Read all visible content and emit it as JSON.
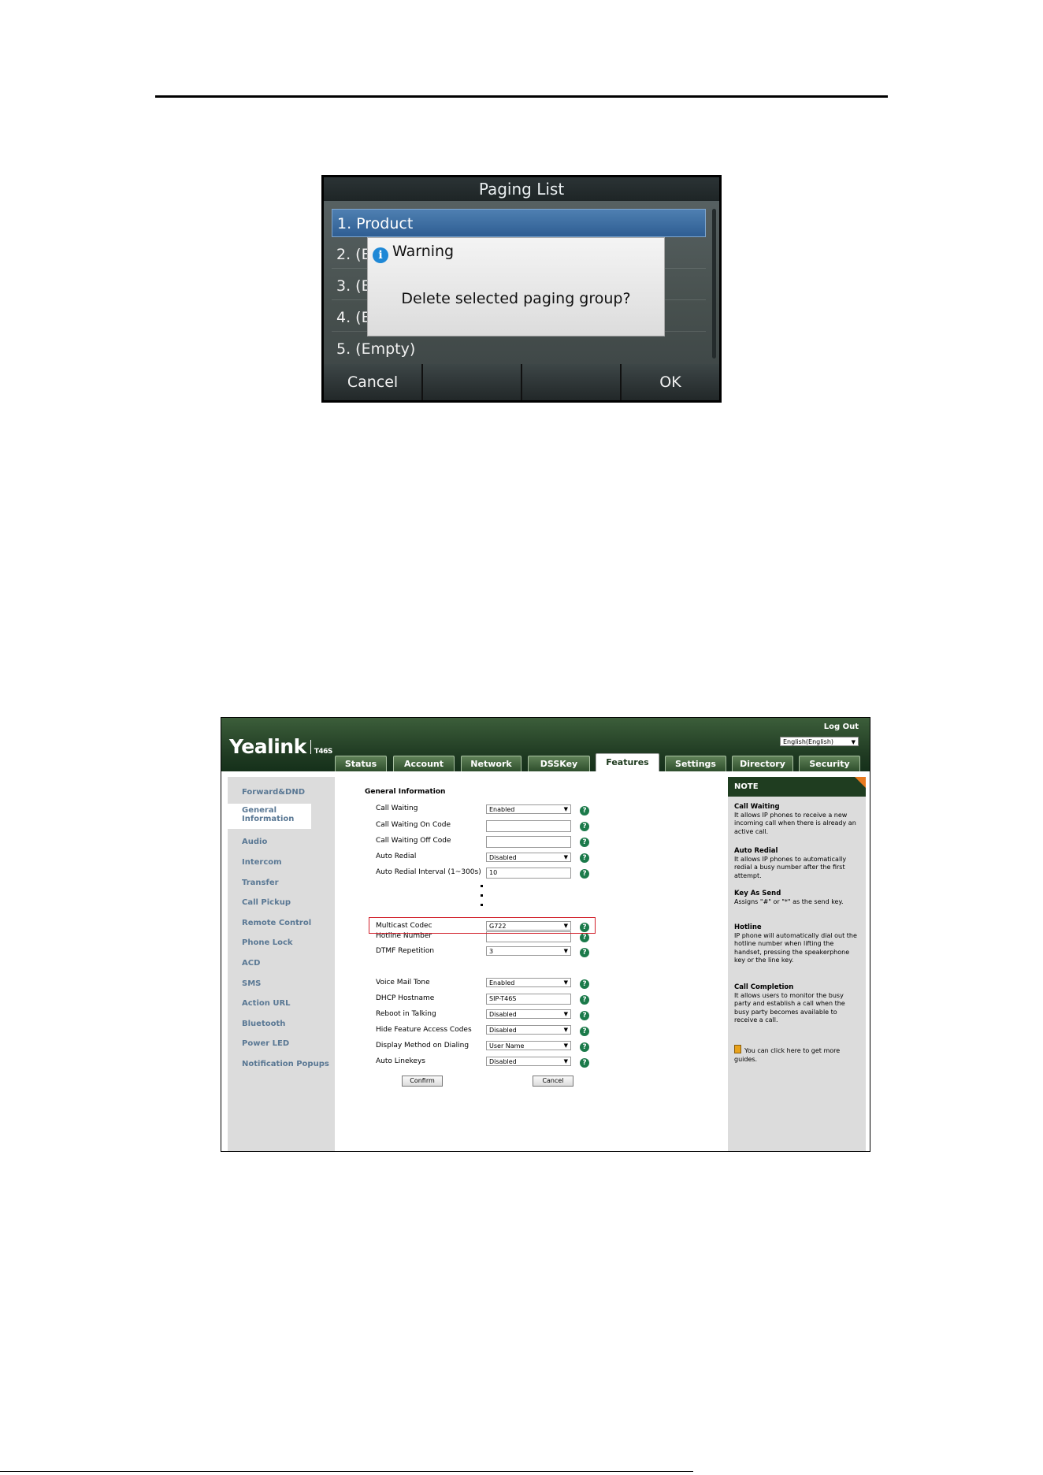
{
  "phone_screen": {
    "title": "Paging List",
    "rows": [
      "1. Product",
      "2. (En",
      "3. (En",
      "4. (En",
      "5. (Empty)"
    ],
    "dialog": {
      "title": "Warning",
      "message": "Delete selected paging group?"
    },
    "softkeys": [
      "Cancel",
      "",
      "",
      "OK"
    ]
  },
  "web": {
    "brand": "Yealink",
    "model": "T46S",
    "logout": "Log Out",
    "language": "English(English)",
    "tabs": [
      "Status",
      "Account",
      "Network",
      "DSSKey",
      "Features",
      "Settings",
      "Directory",
      "Security"
    ],
    "active_tab": "Features",
    "sidebar": [
      "Forward&DND",
      "General Information",
      "Audio",
      "Intercom",
      "Transfer",
      "Call Pickup",
      "Remote Control",
      "Phone Lock",
      "ACD",
      "SMS",
      "Action URL",
      "Bluetooth",
      "Power LED",
      "Notification Popups"
    ],
    "active_sidebar": "General Information",
    "section_title": "General Information",
    "fields_top": [
      {
        "label": "Call Waiting",
        "type": "select",
        "value": "Enabled"
      },
      {
        "label": "Call Waiting On Code",
        "type": "input",
        "value": ""
      },
      {
        "label": "Call Waiting Off Code",
        "type": "input",
        "value": ""
      },
      {
        "label": "Auto Redial",
        "type": "select",
        "value": "Disabled"
      },
      {
        "label": "Auto Redial Interval (1~300s)",
        "type": "input",
        "value": "10"
      }
    ],
    "fields_bottom": [
      {
        "label": "Hotline Number",
        "type": "input",
        "value": ""
      },
      {
        "label": "DTMF Repetition",
        "type": "select",
        "value": "3"
      },
      {
        "label": "Multicast Codec",
        "type": "select",
        "value": "G722",
        "highlighted": true
      },
      {
        "label": "Voice Mail Tone",
        "type": "select",
        "value": "Enabled"
      },
      {
        "label": "DHCP Hostname",
        "type": "input",
        "value": "SIP-T46S"
      },
      {
        "label": "Reboot in Talking",
        "type": "select",
        "value": "Disabled"
      },
      {
        "label": "Hide Feature Access Codes",
        "type": "select",
        "value": "Disabled"
      },
      {
        "label": "Display Method on Dialing",
        "type": "select",
        "value": "User Name"
      },
      {
        "label": "Auto Linekeys",
        "type": "select",
        "value": "Disabled"
      }
    ],
    "confirm_label": "Confirm",
    "cancel_label": "Cancel",
    "note": {
      "title": "NOTE",
      "items": [
        {
          "heading": "Call Waiting",
          "text": "It allows IP phones to receive a new incoming call when there is already an active call."
        },
        {
          "heading": "Auto Redial",
          "text": "It allows IP phones to automatically redial a busy number after the first attempt."
        },
        {
          "heading": "Key As Send",
          "text": "Assigns \"#\" or \"*\" as the send key."
        },
        {
          "heading": "Hotline",
          "text": "IP phone will automatically dial out the hotline number when lifting the handset, pressing the speakerphone key or the line key."
        },
        {
          "heading": "Call Completion",
          "text": "It allows users to monitor the busy party and establish a call when the busy party becomes available to receive a call."
        }
      ],
      "guide_text": "You can click here to get more guides."
    }
  }
}
